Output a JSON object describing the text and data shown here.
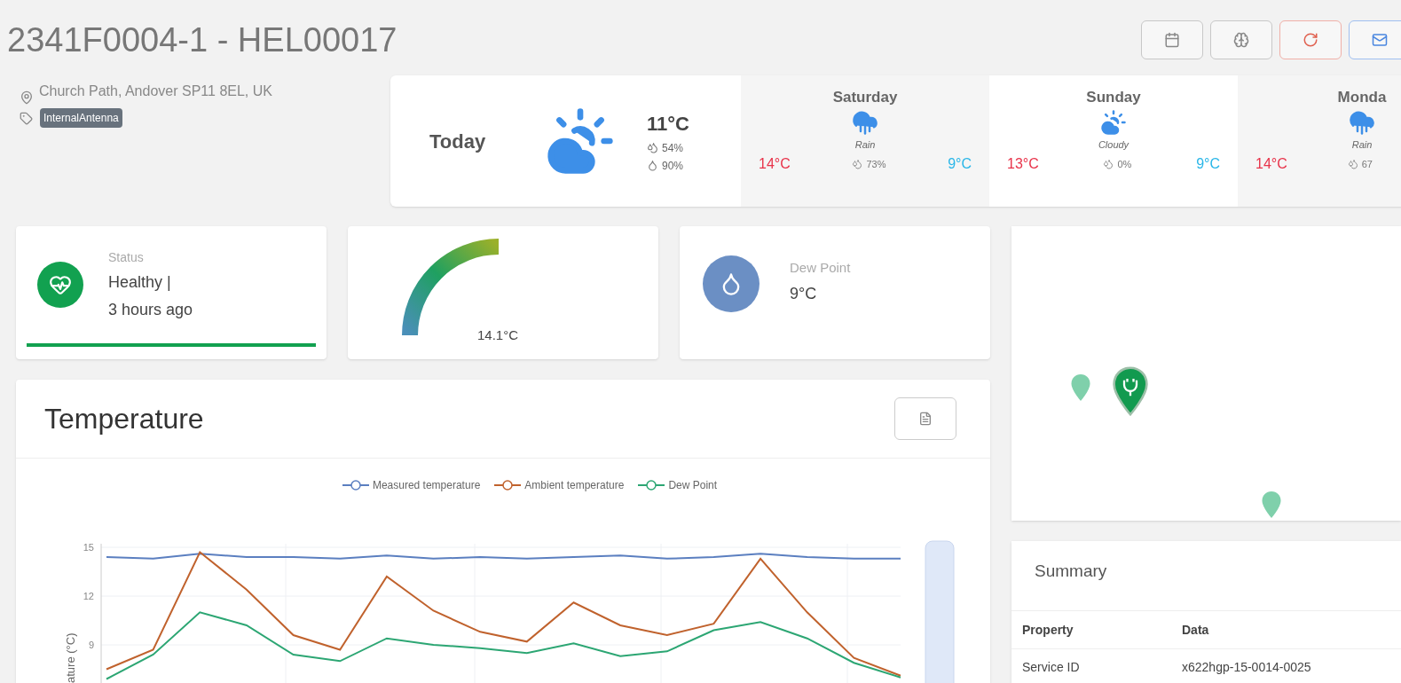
{
  "header": {
    "title": "2341F0004-1 - HEL00017",
    "buttons": [
      {
        "kind": "calendar"
      },
      {
        "kind": "brain"
      },
      {
        "kind": "refresh"
      },
      {
        "kind": "mail"
      }
    ]
  },
  "location": {
    "address": "Church Path, Andover SP11 8EL, UK",
    "tag": "InternalAntenna"
  },
  "weather": {
    "today": {
      "label": "Today",
      "temperature": "11°C",
      "rain_chance": "54%",
      "humidity": "90%"
    },
    "forecast": [
      {
        "day": "Saturday",
        "kind": "rain",
        "condition": "Rain",
        "high": "14°C",
        "rain_chance": "73%",
        "low": "9°C"
      },
      {
        "day": "Sunday",
        "kind": "cloudy",
        "condition": "Cloudy",
        "high": "13°C",
        "rain_chance": "0%",
        "low": "9°C"
      },
      {
        "day": "Monda",
        "kind": "rain",
        "condition": "Rain",
        "high": "14°C",
        "rain_chance": "67"
      }
    ]
  },
  "status": {
    "label": "Status",
    "value": "Healthy |",
    "time": "3 hours ago"
  },
  "gauge": {
    "reading": "14.1°C"
  },
  "dew_point": {
    "label": "Dew Point",
    "value": "9°C"
  },
  "temperature_panel": {
    "title": "Temperature",
    "chart_data": {
      "type": "line",
      "ylabel": "ature (°C)",
      "grid": true,
      "legend": "top",
      "ylim": [
        6.6,
        15.3
      ],
      "yticks": [
        9,
        12,
        15
      ],
      "series": [
        {
          "name": "Measured temperature",
          "color": "#5b7fc0",
          "values": [
            14.4,
            14.3,
            14.6,
            14.4,
            14.4,
            14.3,
            14.5,
            14.3,
            14.4,
            14.3,
            14.4,
            14.5,
            14.3,
            14.4,
            14.6,
            14.4,
            14.3,
            14.3
          ]
        },
        {
          "name": "Ambient temperature",
          "color": "#c0622d",
          "values": [
            7.5,
            8.7,
            14.7,
            12.4,
            9.6,
            8.7,
            13.2,
            11.1,
            9.8,
            9.2,
            11.6,
            10.2,
            9.6,
            10.3,
            14.3,
            11.0,
            8.2,
            7.1
          ]
        },
        {
          "name": "Dew Point",
          "color": "#2ca673",
          "values": [
            6.9,
            8.4,
            11.0,
            10.2,
            8.4,
            8.0,
            9.4,
            9.0,
            8.8,
            8.5,
            9.1,
            8.3,
            8.6,
            9.9,
            10.4,
            9.4,
            7.9,
            7.0
          ]
        }
      ]
    }
  },
  "map": {
    "pins": [
      {
        "selected": false
      },
      {
        "selected": true
      },
      {
        "selected": false
      }
    ]
  },
  "summary": {
    "title": "Summary",
    "columns": [
      "Property",
      "Data"
    ],
    "rows": [
      [
        "Service ID",
        "x622hgp-15-0014-0025"
      ]
    ]
  }
}
